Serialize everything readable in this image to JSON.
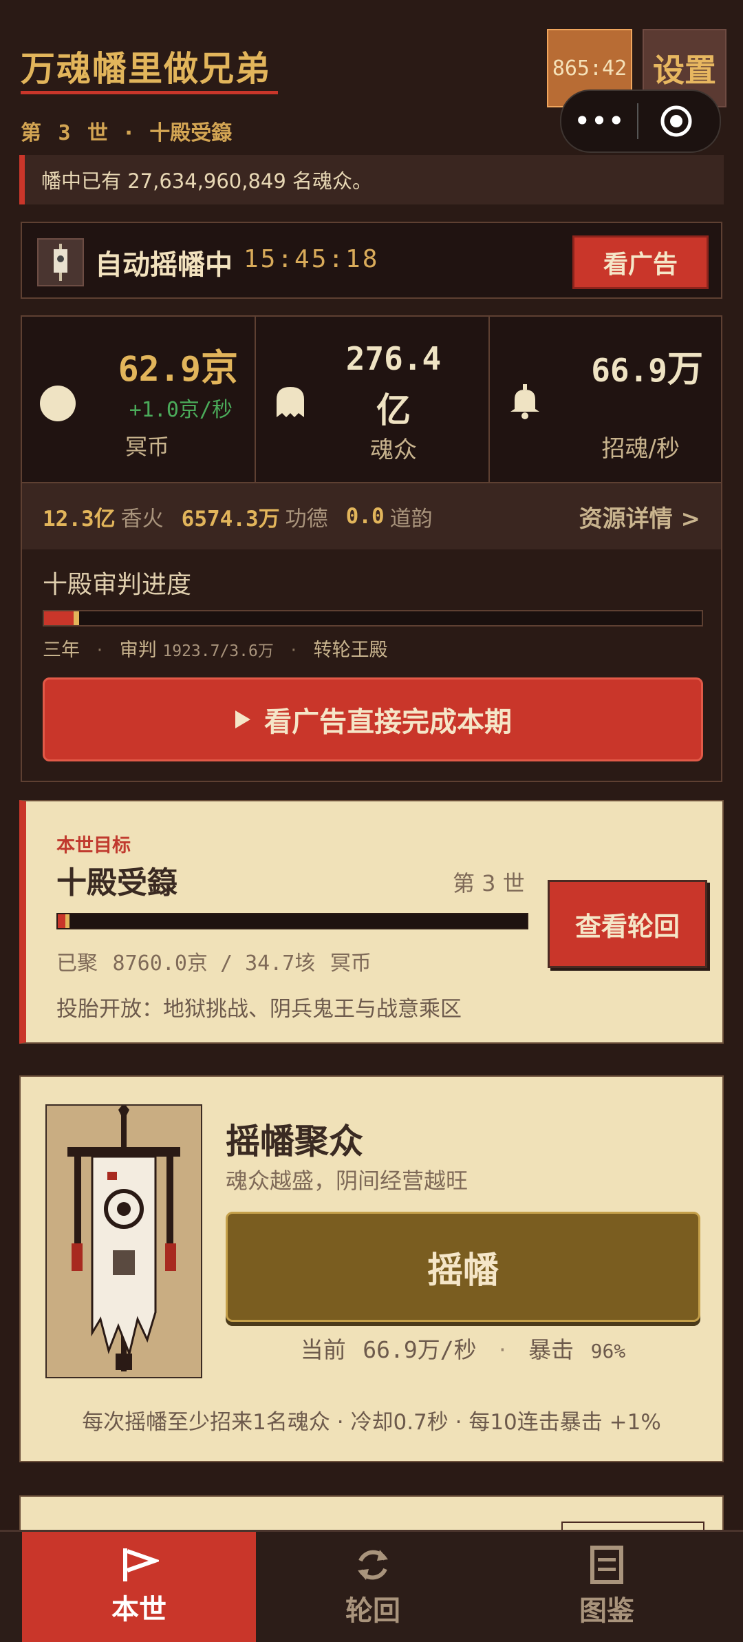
{
  "header": {
    "title": "万魂幡里做兄弟",
    "subtitle_prefix": "第",
    "generation": "3",
    "subtitle_suffix": "世",
    "separator": "·",
    "stage": "十殿受籙",
    "timer": "865:42",
    "settings_label": "设置"
  },
  "notice": {
    "text": "幡中已有 27,634,960,849 名魂众。"
  },
  "auto": {
    "label": "自动摇幡中",
    "time": "15:45:18",
    "ad_label": "看广告"
  },
  "stats": [
    {
      "value": "62.9",
      "unit": "京",
      "rate": "+1.0京/秒",
      "label": "冥币",
      "icon": "coin-icon"
    },
    {
      "value": "276.4",
      "unit": "亿",
      "label": "魂众",
      "icon": "ghost-icon"
    },
    {
      "value": "66.9",
      "unit": "万",
      "label": "招魂/秒",
      "icon": "bell-icon"
    }
  ],
  "resources": {
    "incense_value": "12.3亿",
    "incense_label": "香火",
    "merit_value": "6574.3万",
    "merit_label": "功德",
    "dao_value": "0.0",
    "dao_label": "道韵",
    "details_label": "资源详情 >"
  },
  "judgement": {
    "title": "十殿审判进度",
    "progress": 0.053,
    "period": "三年",
    "sep": "·",
    "trial_label": "审判",
    "trial_value": "1923.7/3.6万",
    "hall": "转轮王殿",
    "button_label": "看广告直接完成本期"
  },
  "goal": {
    "kicker": "本世目标",
    "title": "十殿受籙",
    "generation_label": "第 3 世",
    "progress": 0.025,
    "progress_prefix": "已聚",
    "progress_value": "8760.0京 / 34.7垓",
    "currency": "冥币",
    "unlock_text": "投胎开放：地狱挑战、阴兵鬼王与战意乘区",
    "cycle_button": "查看轮回"
  },
  "summon": {
    "title": "摇幡聚众",
    "subtitle": "魂众越盛，阴间经营越旺",
    "button_label": "摇幡",
    "current_label": "当前",
    "current_value": "66.9万/秒",
    "sep": "·",
    "crit_label": "暴击",
    "crit_value": "96%",
    "footnote": "每次摇幡至少招来1名魂众 · 冷却0.7秒 · 每10连击暴击 +1%"
  },
  "tabs": [
    {
      "label": "本世",
      "icon": "flag-icon",
      "active": true
    },
    {
      "label": "轮回",
      "icon": "refresh-icon",
      "active": false
    },
    {
      "label": "图鉴",
      "icon": "book-icon",
      "active": false
    }
  ],
  "colors": {
    "accent": "#c9362a",
    "gold": "#e2b55b",
    "background": "#2a1a15",
    "card": "#f0e1b8"
  }
}
